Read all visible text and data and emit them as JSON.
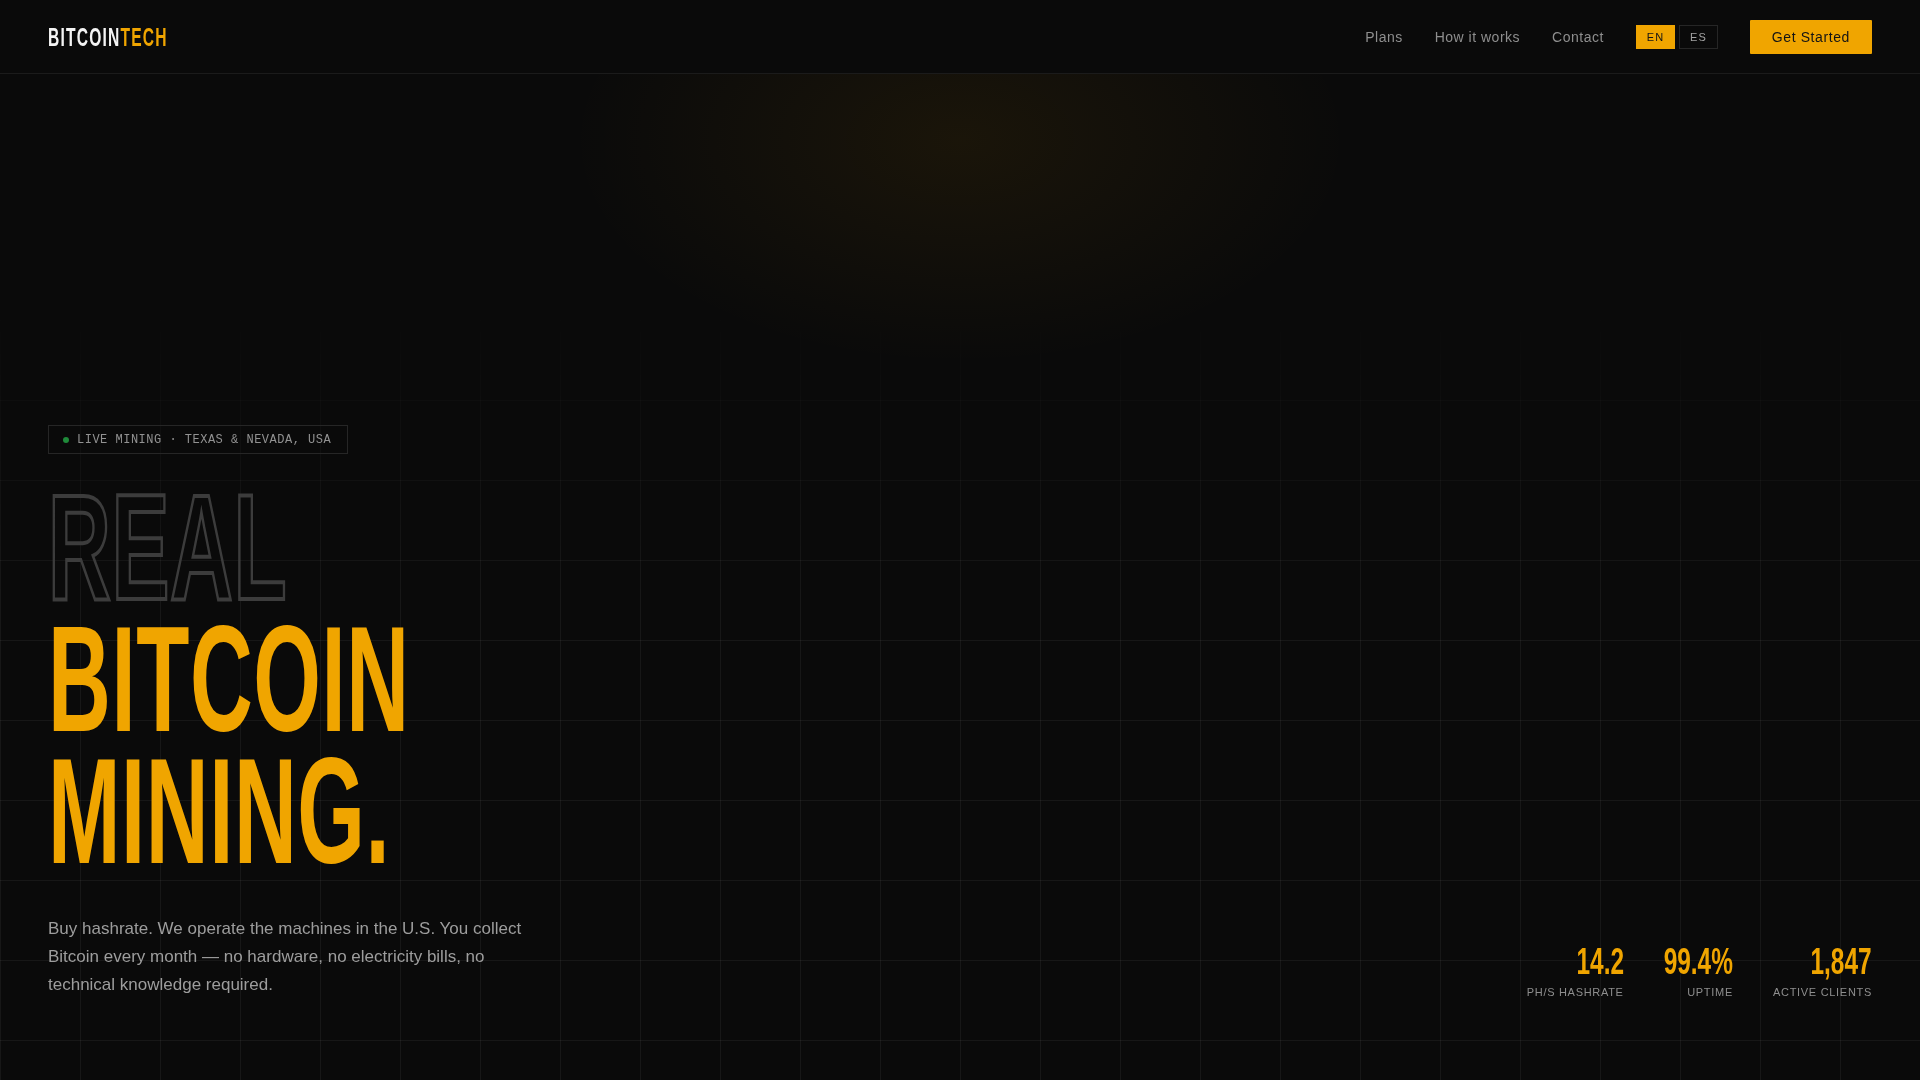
{
  "nav": {
    "logo": {
      "main": "BITCOIN",
      "accent": "TECH"
    },
    "links": [
      "Plans",
      "How it works",
      "Contact"
    ],
    "languages": [
      {
        "label": "EN",
        "selected": true
      },
      {
        "label": "ES",
        "selected": false
      }
    ],
    "cta": "Get Started"
  },
  "hero": {
    "badge": {
      "live": true,
      "text": "LIVE MINING · TEXAS & NEVADA, USA"
    },
    "title_lines": [
      {
        "text": "REAL",
        "kind": "outline"
      },
      {
        "text": "BITCOIN",
        "kind": "solid"
      },
      {
        "text": "MINING.",
        "kind": "solid"
      }
    ],
    "description": "Buy hashrate. We operate the machines in the U.S. You collect Bitcoin every month — no hardware, no electricity bills, no technical knowledge required.",
    "stats": [
      {
        "value": "14.2",
        "label": "PH/S HASHRATE"
      },
      {
        "value": "99.4%",
        "label": "UPTIME"
      },
      {
        "value": "1,847",
        "label": "ACTIVE CLIENTS"
      }
    ]
  }
}
